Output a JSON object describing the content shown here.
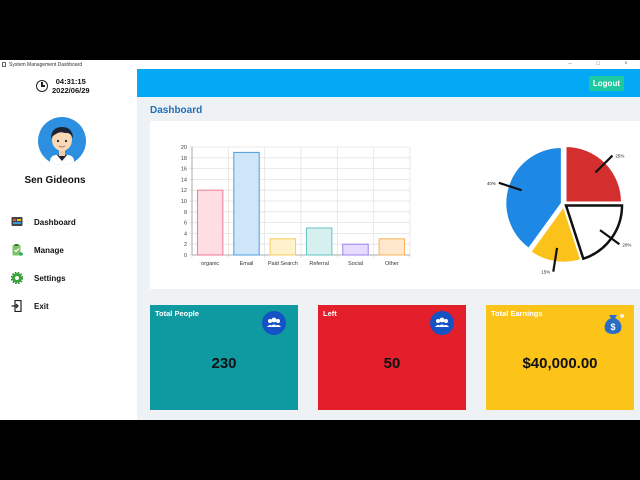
{
  "window": {
    "title": "System Management Dashboard"
  },
  "sidebar": {
    "time": "04:31:15",
    "date": "2022/06/29",
    "username": "Sen Gideons",
    "items": [
      {
        "label": "Dashboard",
        "icon": "dashboard-icon"
      },
      {
        "label": "Manage",
        "icon": "clipboard-icon"
      },
      {
        "label": "Settings",
        "icon": "gear-icon"
      },
      {
        "label": "Exit",
        "icon": "exit-icon"
      }
    ]
  },
  "header": {
    "logout_label": "Logout",
    "accent": "#03a9f4"
  },
  "main": {
    "title": "Dashboard"
  },
  "cards": [
    {
      "title": "Total People",
      "value": "230",
      "color": "#0e9aa0",
      "icon": "people-icon"
    },
    {
      "title": "Left",
      "value": "50",
      "color": "#e21f2a",
      "icon": "people-icon"
    },
    {
      "title": "Total Earnings",
      "value": "$40,000.00",
      "color": "#fcc419",
      "icon": "money-bag-icon"
    }
  ],
  "chart_data": [
    {
      "type": "bar",
      "categories": [
        "organic",
        "Email",
        "Paid Search",
        "Referral",
        "Social",
        "Other"
      ],
      "values": [
        12,
        19,
        3,
        5,
        2,
        3
      ],
      "ylim": [
        0,
        20
      ],
      "yticks": [
        "0",
        "2",
        "4",
        "6",
        "8",
        "10",
        "12",
        "14",
        "16",
        "18",
        "20"
      ],
      "fills": [
        "#ffdde3",
        "#cfe5f8",
        "#fff2cc",
        "#d6f0f0",
        "#e6dcff",
        "#ffe8cc"
      ],
      "strokes": [
        "#f27a93",
        "#4a9fe0",
        "#f5cc5c",
        "#67c1c1",
        "#9f7ff0",
        "#f9b15e"
      ],
      "grid": true
    },
    {
      "type": "pie",
      "slices": [
        {
          "label": "25%",
          "value": 25,
          "color": "#d32f2f"
        },
        {
          "label": "20%",
          "value": 20,
          "color": "#ffffff"
        },
        {
          "label": "15%",
          "value": 15,
          "color": "#fbc21b"
        },
        {
          "label": "40%",
          "value": 40,
          "color": "#1e88e5"
        }
      ]
    }
  ]
}
